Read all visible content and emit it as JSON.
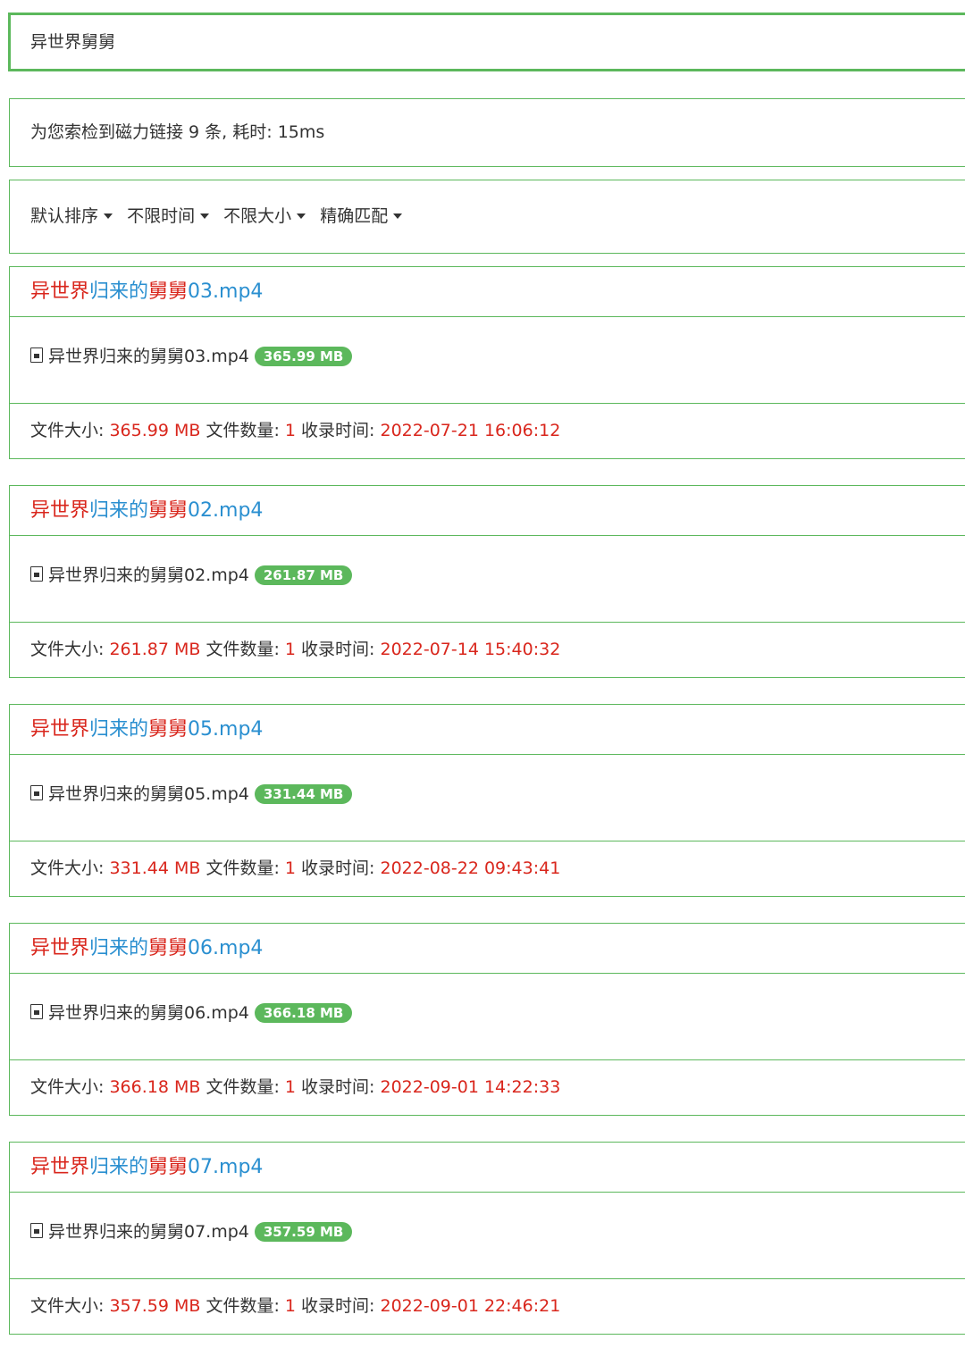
{
  "search": {
    "query": "异世界舅舅"
  },
  "summary": {
    "text": "为您索检到磁力链接 9 条, 耗时: 15ms"
  },
  "filters": [
    "默认排序",
    "不限时间",
    "不限大小",
    "精确匹配"
  ],
  "labels": {
    "size": "文件大小:",
    "count": "文件数量:",
    "date": "收录时间:"
  },
  "colors": {
    "accent": "#5cb85c",
    "highlight_red": "#d9261c",
    "link_blue": "#2a8fd0"
  },
  "icons": {
    "file": "file-video-icon",
    "caret": "caret-down-icon"
  },
  "results": [
    {
      "title_parts": [
        "异世界",
        "归来的",
        "舅舅",
        "03.mp4"
      ],
      "filename": "异世界归来的舅舅03.mp4",
      "badge": "365.99 MB",
      "size": "365.99 MB",
      "count": "1",
      "date": "2022-07-21 16:06:12"
    },
    {
      "title_parts": [
        "异世界",
        "归来的",
        "舅舅",
        "02.mp4"
      ],
      "filename": "异世界归来的舅舅02.mp4",
      "badge": "261.87 MB",
      "size": "261.87 MB",
      "count": "1",
      "date": "2022-07-14 15:40:32"
    },
    {
      "title_parts": [
        "异世界",
        "归来的",
        "舅舅",
        "05.mp4"
      ],
      "filename": "异世界归来的舅舅05.mp4",
      "badge": "331.44 MB",
      "size": "331.44 MB",
      "count": "1",
      "date": "2022-08-22 09:43:41"
    },
    {
      "title_parts": [
        "异世界",
        "归来的",
        "舅舅",
        "06.mp4"
      ],
      "filename": "异世界归来的舅舅06.mp4",
      "badge": "366.18 MB",
      "size": "366.18 MB",
      "count": "1",
      "date": "2022-09-01 14:22:33"
    },
    {
      "title_parts": [
        "异世界",
        "归来的",
        "舅舅",
        "07.mp4"
      ],
      "filename": "异世界归来的舅舅07.mp4",
      "badge": "357.59 MB",
      "size": "357.59 MB",
      "count": "1",
      "date": "2022-09-01 22:46:21"
    }
  ]
}
